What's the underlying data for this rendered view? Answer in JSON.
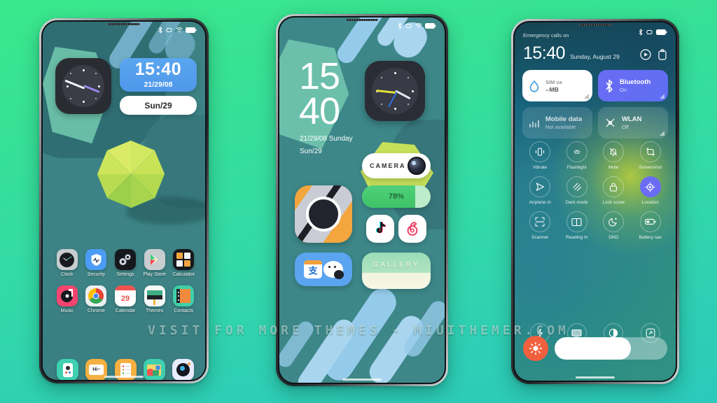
{
  "theme": {
    "accent_blue": "#5aa6f0",
    "accent_purple": "#6b6cf5",
    "accent_orange": "#f1603e",
    "wallpaper_teal": "#3d8385",
    "page_bg_top": "#3ae88c",
    "page_bg_bottom": "#2cc9bb"
  },
  "watermark": {
    "text": "VISIT FOR MORE THEMES - MIUITHEMER.COM"
  },
  "phone1": {
    "statusbar": {
      "icons": [
        "bluetooth-icon",
        "vibrate-icon",
        "wifi-icon",
        "battery-icon"
      ]
    },
    "widgets": {
      "analog_clock": {
        "name": "Clock"
      },
      "time": {
        "time": "15:40",
        "date": "21/29/08"
      },
      "date_pill": {
        "text": "Sun/29"
      }
    },
    "apps": [
      {
        "label": "Clock",
        "icon": "clock-icon"
      },
      {
        "label": "Security",
        "icon": "shield-icon"
      },
      {
        "label": "Settings",
        "icon": "gear-icon"
      },
      {
        "label": "Play Store",
        "icon": "play-store-icon"
      },
      {
        "label": "Calculator",
        "icon": "calculator-icon"
      },
      {
        "label": "Music",
        "icon": "music-icon"
      },
      {
        "label": "Chrome",
        "icon": "chrome-icon"
      },
      {
        "label": "Calendar",
        "icon": "calendar-icon",
        "day": "29"
      },
      {
        "label": "Themes",
        "icon": "themes-icon"
      },
      {
        "label": "Contacts",
        "icon": "contacts-icon"
      }
    ],
    "dock": [
      {
        "label": "Phone",
        "icon": "phone-icon"
      },
      {
        "label": "Messages",
        "icon": "messages-icon",
        "text": "Hi~"
      },
      {
        "label": "Notes",
        "icon": "notes-icon"
      },
      {
        "label": "Gallery",
        "icon": "gallery-icon"
      },
      {
        "label": "Camera",
        "icon": "camera-icon"
      }
    ]
  },
  "phone2": {
    "statusbar": {
      "icons": [
        "bluetooth-icon",
        "vibrate-icon",
        "wifi-icon",
        "battery-icon"
      ]
    },
    "clock": {
      "hour": "15",
      "minute": "40",
      "date_line": "21/29/08 Sunday",
      "day_line": "Sun/29"
    },
    "widgets": {
      "analog_clock": {
        "name": "Clock"
      },
      "camera": {
        "label": "CAMERA"
      },
      "battery": {
        "percent": "78%",
        "value": 78
      },
      "gallery": {
        "label": "GALLERY"
      }
    },
    "apps": [
      {
        "label": "Camera",
        "icon": "camera-large-icon"
      },
      {
        "label": "TikTok",
        "icon": "tiktok-icon"
      },
      {
        "label": "Music",
        "icon": "netease-music-icon"
      },
      {
        "label": "Payment",
        "icon": "alipay-wechat-icon"
      }
    ]
  },
  "phone3": {
    "statusbar": {
      "emergency": "Emergency calls on",
      "icons": [
        "bluetooth-icon",
        "vibrate-icon",
        "battery-icon"
      ]
    },
    "header": {
      "time": "15:40",
      "date": "Sunday, August 29",
      "actions": [
        "media-icon",
        "clipboard-icon"
      ]
    },
    "cards": [
      {
        "title": "",
        "sub": "--MB",
        "meta_left": "",
        "meta_right": "SIM ca",
        "icon": "data-drop-icon",
        "style": "white"
      },
      {
        "title": "Bluetooth",
        "sub": "On",
        "icon": "bluetooth-icon",
        "style": "blue"
      },
      {
        "title": "Mobile data",
        "sub": "Not available",
        "icon": "signal-bars-icon",
        "style": "dim"
      },
      {
        "title": "WLAN",
        "sub": "Off",
        "icon": "wlan-icon",
        "style": "glow"
      }
    ],
    "toggles": [
      {
        "label": "Vibrate",
        "icon": "vibrate-icon",
        "on": false
      },
      {
        "label": "Flashlight",
        "icon": "flashlight-icon",
        "on": false
      },
      {
        "label": "Mute",
        "icon": "mute-bell-icon",
        "on": false
      },
      {
        "label": "Screenshot",
        "icon": "screenshot-icon",
        "on": false
      },
      {
        "label": "Airplane m",
        "icon": "airplane-icon",
        "on": false
      },
      {
        "label": "Dark mode",
        "icon": "dark-mode-icon",
        "on": false
      },
      {
        "label": "Lock scree",
        "icon": "lock-icon",
        "on": false
      },
      {
        "label": "Location",
        "icon": "location-icon",
        "on": true
      },
      {
        "label": "Scanner",
        "icon": "scanner-icon",
        "on": false
      },
      {
        "label": "Reading m",
        "icon": "reading-icon",
        "on": false
      },
      {
        "label": "DND",
        "icon": "dnd-moon-icon",
        "on": false
      },
      {
        "label": "Battery sav",
        "icon": "battery-saver-icon",
        "on": false
      }
    ],
    "extra_row": [
      {
        "icon": "lightning-icon"
      },
      {
        "icon": "cast-screen-icon"
      },
      {
        "icon": "contrast-icon"
      },
      {
        "icon": "expand-icon"
      }
    ],
    "brightness": {
      "icon": "sun-icon",
      "value": 68
    }
  }
}
